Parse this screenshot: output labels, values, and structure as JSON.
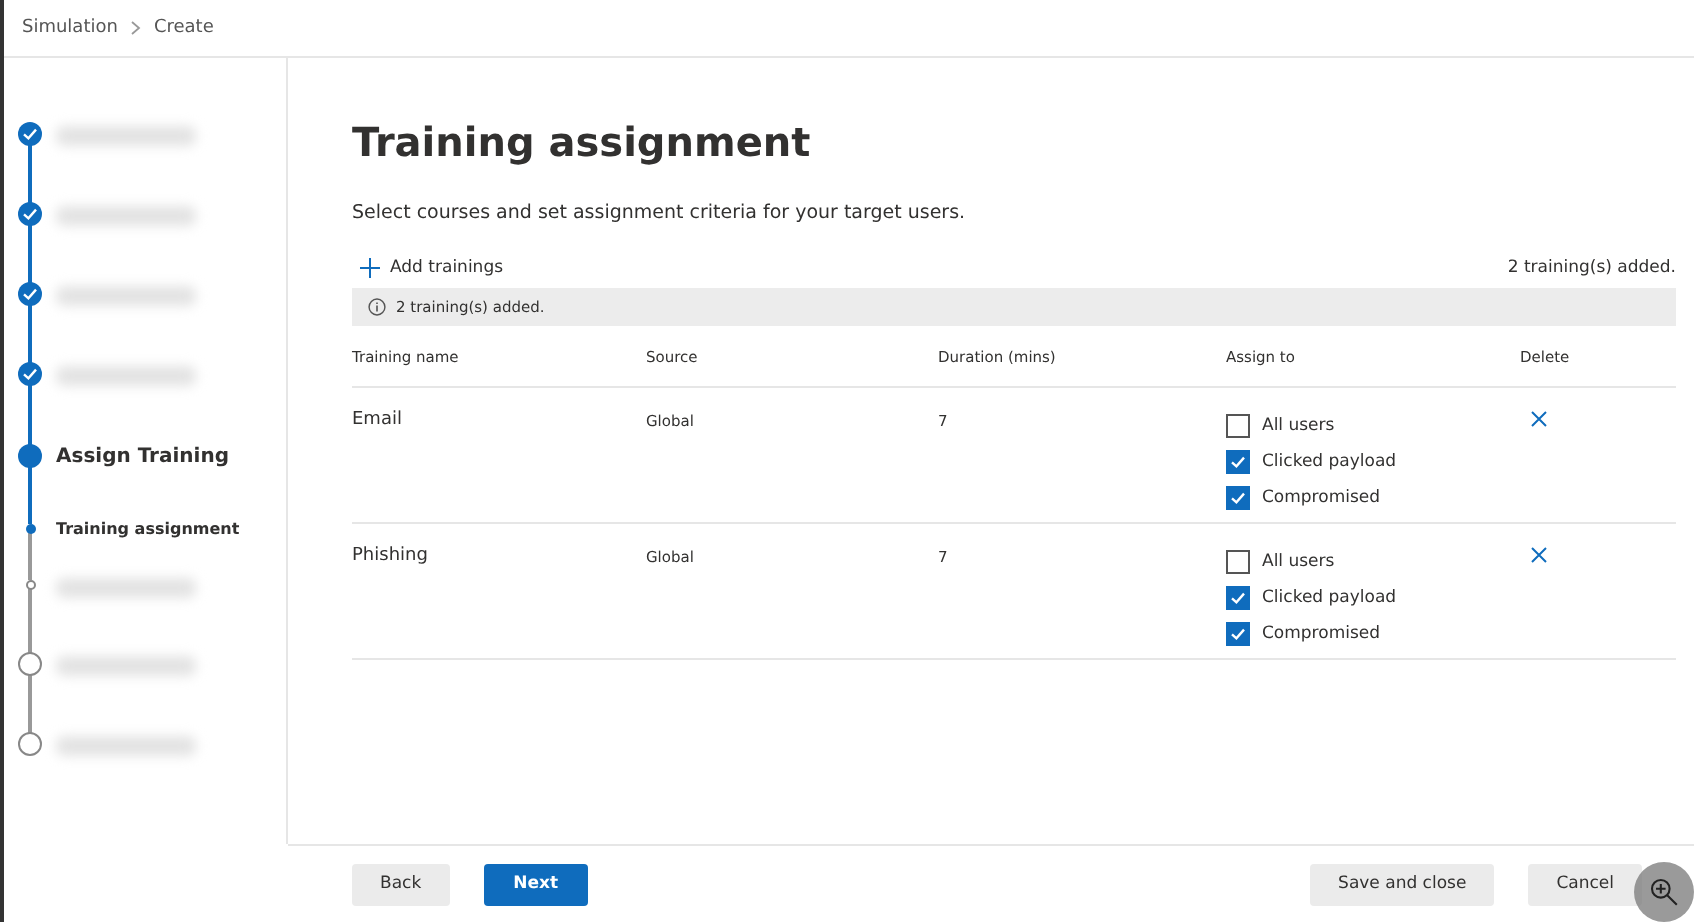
{
  "breadcrumb": [
    "Simulation",
    "Create"
  ],
  "steps": [
    {
      "kind": "done"
    },
    {
      "kind": "done"
    },
    {
      "kind": "done"
    },
    {
      "kind": "done"
    },
    {
      "kind": "current",
      "label": "Assign Training"
    },
    {
      "kind": "currentsub",
      "label": "Training assignment"
    },
    {
      "kind": "pendingsub"
    },
    {
      "kind": "pending"
    },
    {
      "kind": "pending"
    }
  ],
  "title": "Training assignment",
  "subtitle": "Select courses and set assignment criteria for your target users.",
  "add_button": "Add trainings",
  "count_text": "2 training(s) added.",
  "info_bar": "2 training(s) added.",
  "table": {
    "columns": [
      "Training name",
      "Source",
      "Duration (mins)",
      "Assign to",
      "Delete"
    ],
    "rows": [
      {
        "name": "Email",
        "source": "Global",
        "duration": "7",
        "assign": [
          {
            "label": "All users",
            "checked": false
          },
          {
            "label": "Clicked payload",
            "checked": true
          },
          {
            "label": "Compromised",
            "checked": true
          }
        ]
      },
      {
        "name": "Phishing",
        "source": "Global",
        "duration": "7",
        "assign": [
          {
            "label": "All users",
            "checked": false
          },
          {
            "label": "Clicked payload",
            "checked": true
          },
          {
            "label": "Compromised",
            "checked": true
          }
        ]
      }
    ]
  },
  "footer": {
    "back": "Back",
    "next": "Next",
    "save": "Save and close",
    "cancel": "Cancel"
  }
}
